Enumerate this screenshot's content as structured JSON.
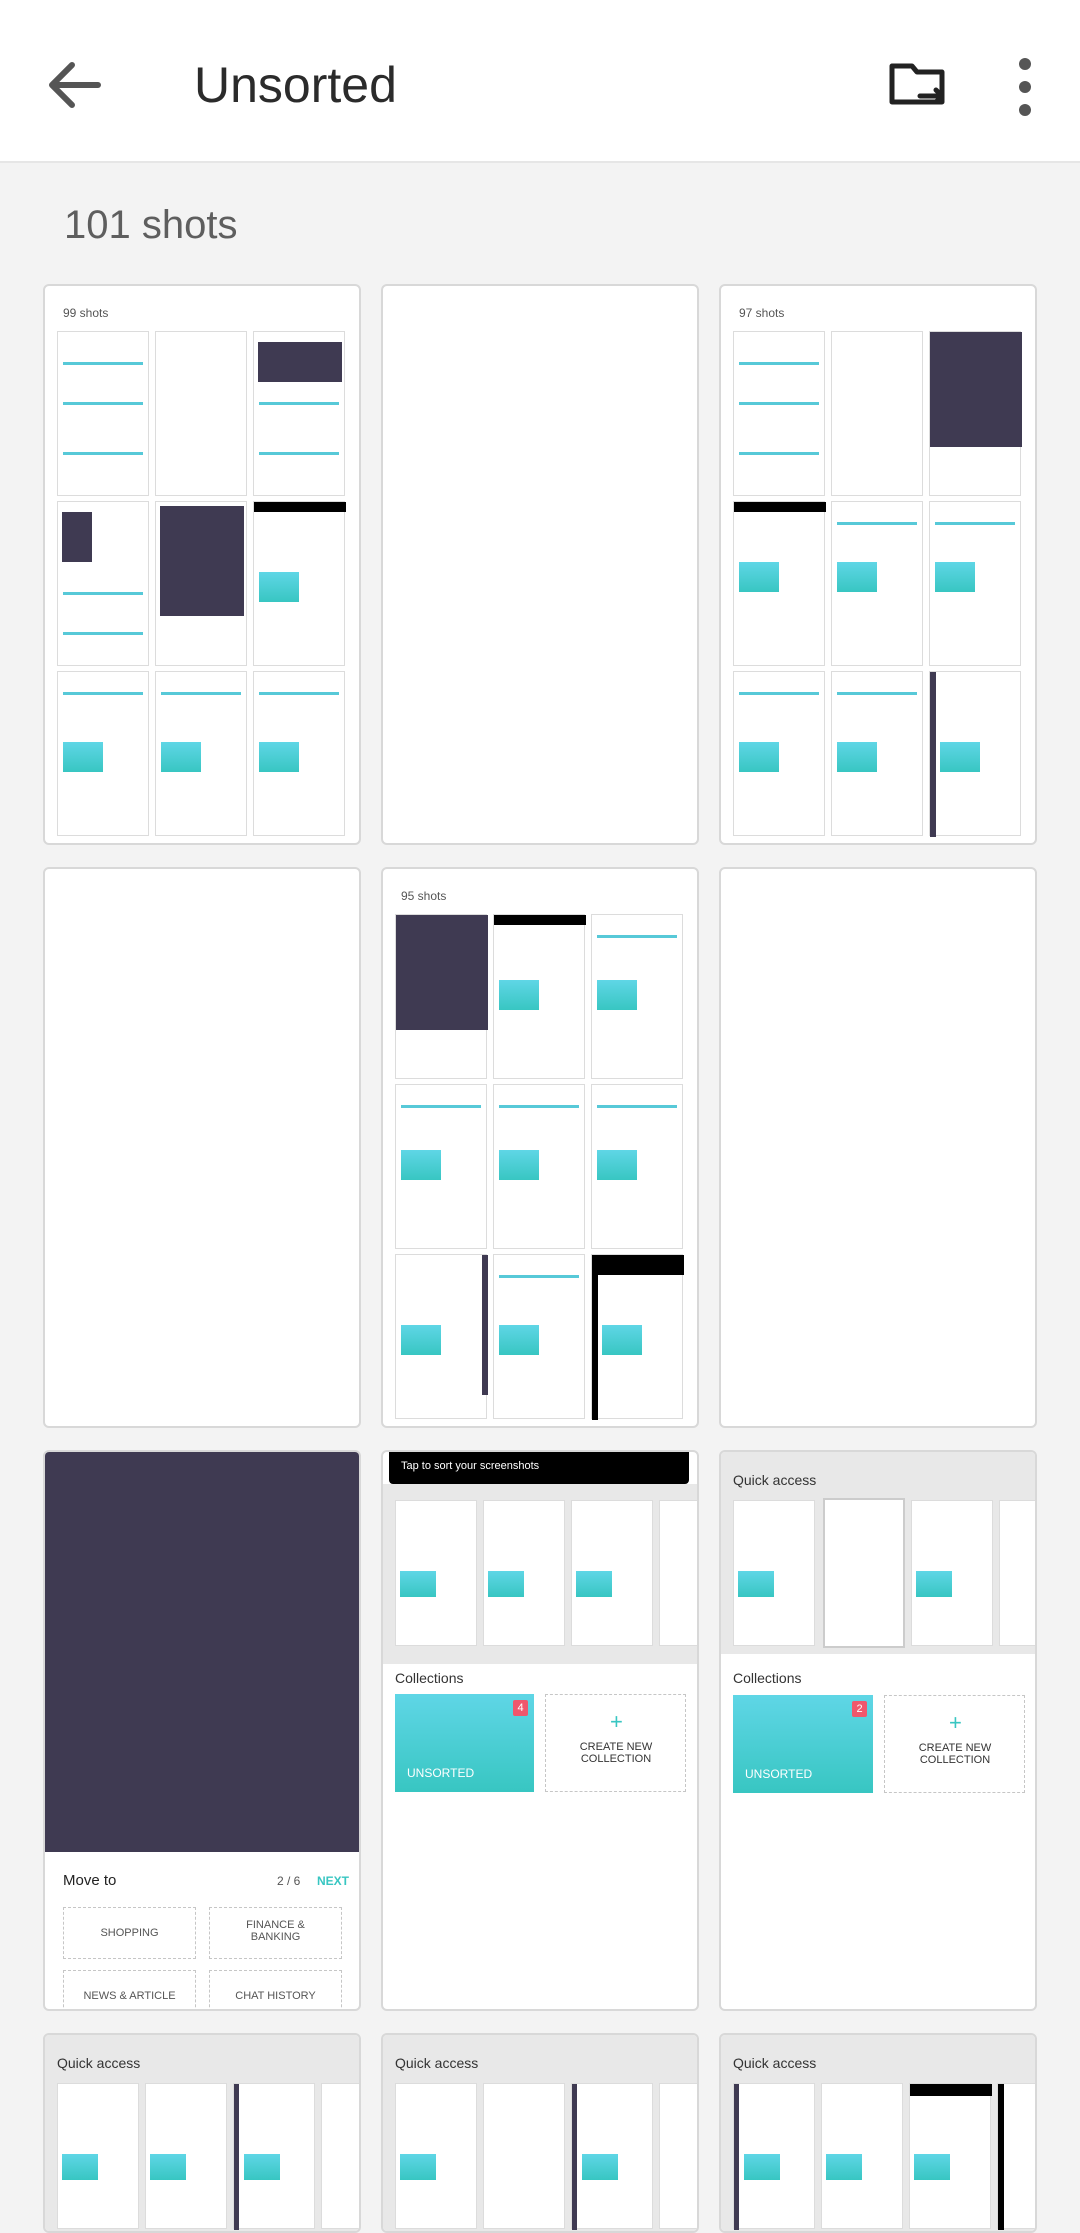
{
  "header": {
    "title": "Unsorted",
    "icons": [
      "back-arrow-icon",
      "move-folder-icon",
      "more-vert-icon"
    ]
  },
  "count_label": "101 shots",
  "tiles": {
    "t1": {
      "label": "99 shots"
    },
    "t3": {
      "label": "97 shots"
    },
    "t5": {
      "label": "95 shots"
    },
    "t7": {
      "move_to": "Move to",
      "page": "2 / 6",
      "next": "NEXT",
      "options": [
        "SHOPPING",
        "FINANCE & BANKING",
        "NEWS & ARTICLE",
        "CHAT HISTORY"
      ]
    },
    "t8": {
      "banner": "Tap to sort your screenshots",
      "collections": "Collections",
      "badge": "4",
      "unsorted": "UNSORTED",
      "create_new": "CREATE NEW COLLECTION"
    },
    "t9": {
      "quick_access": "Quick access",
      "collections": "Collections",
      "badge": "2",
      "unsorted": "UNSORTED",
      "create_new": "CREATE NEW COLLECTION"
    },
    "t10": {
      "quick_access": "Quick access"
    },
    "t11": {
      "quick_access": "Quick access"
    },
    "t12": {
      "quick_access": "Quick access"
    }
  },
  "colors": {
    "accent": "#38c6c2",
    "dark_tile": "#3f3a52",
    "badge": "#f0576c"
  }
}
